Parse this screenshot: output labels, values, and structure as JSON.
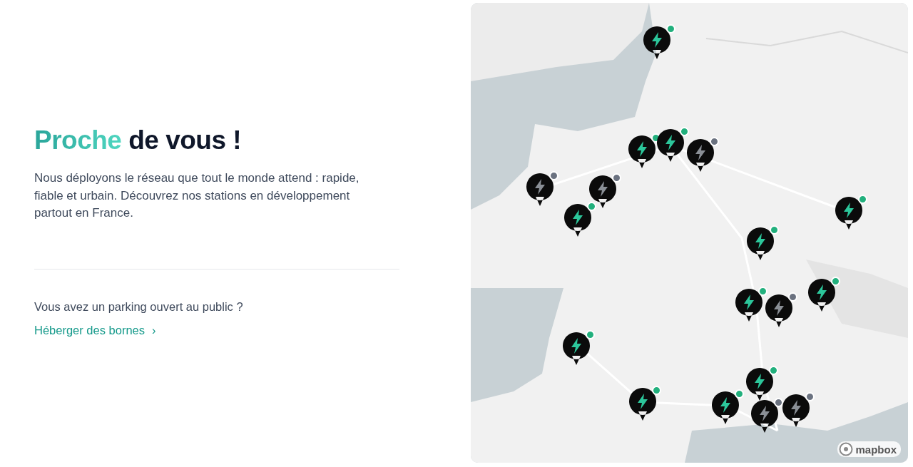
{
  "heading": {
    "highlight": "Proche",
    "rest": "de vous !"
  },
  "intro": "Nous déployons le réseau que tout le monde attend : rapide, fiable et urbain. Découvrez nos stations en développement partout en France.",
  "question": "Vous avez un parking ouvert au public ?",
  "link": {
    "label": "Héberger des bornes",
    "chevron": "›"
  },
  "map": {
    "attribution_logo": "mapbox",
    "markers": [
      {
        "color": "#22b07d"
      },
      {
        "color": "#22b07d"
      },
      {
        "color": "#22b07d"
      },
      {
        "color": "#6b7280"
      },
      {
        "color": "#6b7280"
      },
      {
        "color": "#6b7280"
      },
      {
        "color": "#22b07d"
      },
      {
        "color": "#22b07d"
      },
      {
        "color": "#22b07d"
      },
      {
        "color": "#22b07d"
      },
      {
        "color": "#6b7280"
      },
      {
        "color": "#22b07d"
      },
      {
        "color": "#22b07d"
      },
      {
        "color": "#22b07d"
      },
      {
        "color": "#22b07d"
      },
      {
        "color": "#22b07d"
      },
      {
        "color": "#6b7280"
      },
      {
        "color": "#6b7280"
      }
    ]
  }
}
